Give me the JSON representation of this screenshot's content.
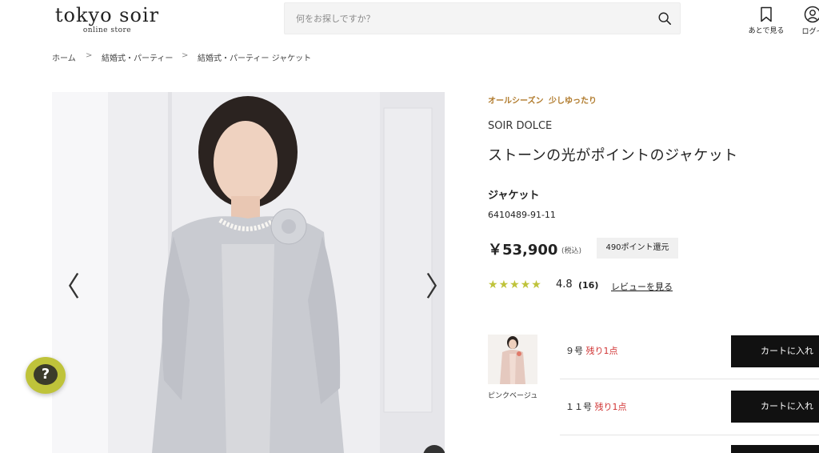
{
  "header": {
    "logo_main": "tokyo soir",
    "logo_sub": "online store",
    "search_placeholder": "何をお探しですか？",
    "wishlist_label": "あとで見る",
    "login_label": "ログイ"
  },
  "breadcrumb": [
    "ホーム",
    "結婚式・パーティー",
    "結婚式・パーティー ジャケット"
  ],
  "product": {
    "tags": [
      "オールシーズン",
      "少しゆったり"
    ],
    "brand": "SOIR DOLCE",
    "title": "ストーンの光がポイントのジャケット",
    "category": "ジャケット",
    "code": "6410489-91-11",
    "price": "￥53,900",
    "tax_note": "(税込)",
    "points": "490ポイント還元",
    "rating": {
      "value": 4.8,
      "display": "4.8",
      "count": "(16)",
      "stars": 5
    },
    "review_link": "レビューを見る"
  },
  "color_option": {
    "label": "ピンクベージュ"
  },
  "sizes": [
    {
      "size": "９号",
      "stock": "残り1点",
      "button": "カートに入れ"
    },
    {
      "size": "１１号",
      "stock": "残り1点",
      "button": "カートに入れ"
    }
  ],
  "colors": {
    "accent_star": "#bfc33a",
    "stock_red": "#d03232",
    "tag_gold": "#b07a2b",
    "button": "#111111"
  },
  "icons": [
    "search-icon",
    "bookmark-icon",
    "user-icon",
    "chevron-left-icon",
    "chevron-right-icon",
    "help-icon",
    "star-icon"
  ]
}
